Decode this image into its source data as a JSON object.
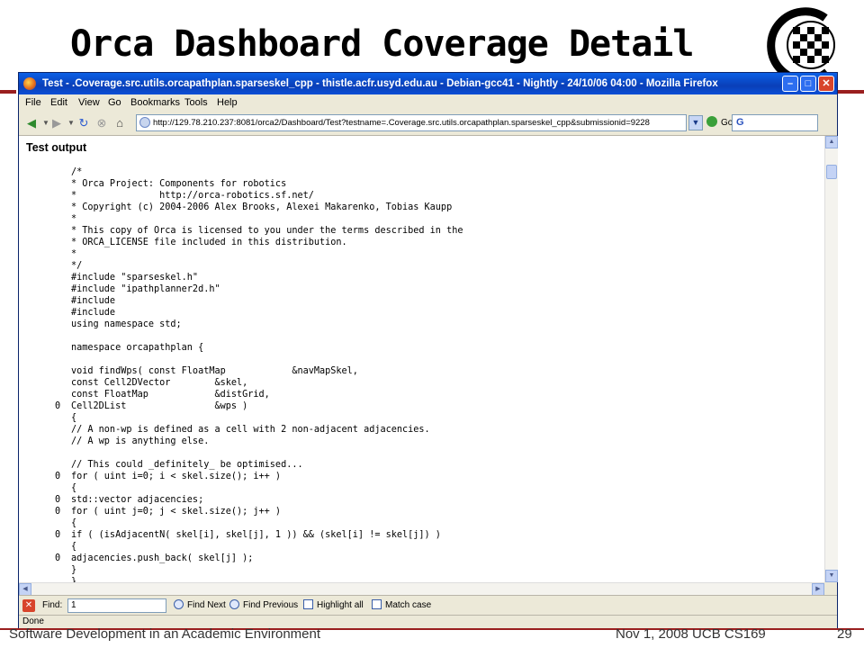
{
  "slide": {
    "title": "Orca Dashboard Coverage Detail",
    "footer_left": "Software Development in an Academic Environment",
    "footer_date": "Nov 1, 2008 UCB CS169",
    "page_number": "29",
    "accent_color": "#9a1f1f"
  },
  "window": {
    "title": "Test - .Coverage.src.utils.orcapathplan.sparseskel_cpp - thistle.acfr.usyd.edu.au - Debian-gcc41 - Nightly - 24/10/06 04:00 - Mozilla Firefox",
    "controls": [
      "minimize",
      "maximize",
      "close"
    ]
  },
  "menu": [
    "File",
    "Edit",
    "View",
    "Go",
    "Bookmarks",
    "Tools",
    "Help"
  ],
  "navbar": {
    "url": "http://129.78.210.237:8081/orca2/Dashboard/Test?testname=.Coverage.src.utils.orcapathplan.sparseskel_cpp&submissionid=9228",
    "go_label": "Go",
    "search_value": "G"
  },
  "content": {
    "heading": "Test output",
    "lines": [
      {
        "count": "",
        "text": "/*"
      },
      {
        "count": "",
        "text": "* Orca Project: Components for robotics"
      },
      {
        "count": "",
        "text": "*               http://orca-robotics.sf.net/"
      },
      {
        "count": "",
        "text": "* Copyright (c) 2004-2006 Alex Brooks, Alexei Makarenko, Tobias Kaupp"
      },
      {
        "count": "",
        "text": "*"
      },
      {
        "count": "",
        "text": "* This copy of Orca is licensed to you under the terms described in the"
      },
      {
        "count": "",
        "text": "* ORCA_LICENSE file included in this distribution."
      },
      {
        "count": "",
        "text": "*"
      },
      {
        "count": "",
        "text": "*/"
      },
      {
        "count": "",
        "text": "#include \"sparseskel.h\""
      },
      {
        "count": "",
        "text": "#include \"ipathplanner2d.h\""
      },
      {
        "count": "",
        "text": "#include"
      },
      {
        "count": "",
        "text": "#include"
      },
      {
        "count": "",
        "text": "using namespace std;"
      },
      {
        "count": "",
        "text": ""
      },
      {
        "count": "",
        "text": "namespace orcapathplan {"
      },
      {
        "count": "",
        "text": ""
      },
      {
        "count": "",
        "text": "void findWps( const FloatMap            &navMapSkel,"
      },
      {
        "count": "",
        "text": "const Cell2DVector        &skel,"
      },
      {
        "count": "",
        "text": "const FloatMap            &distGrid,"
      },
      {
        "count": "0",
        "text": "Cell2DList                &wps )"
      },
      {
        "count": "",
        "text": "{"
      },
      {
        "count": "",
        "text": "// A non-wp is defined as a cell with 2 non-adjacent adjacencies."
      },
      {
        "count": "",
        "text": "// A wp is anything else."
      },
      {
        "count": "",
        "text": ""
      },
      {
        "count": "",
        "text": "// This could _definitely_ be optimised..."
      },
      {
        "count": "0",
        "text": "for ( uint i=0; i < skel.size(); i++ )"
      },
      {
        "count": "",
        "text": "{"
      },
      {
        "count": "0",
        "text": "std::vector adjacencies;"
      },
      {
        "count": "0",
        "text": "for ( uint j=0; j < skel.size(); j++ )"
      },
      {
        "count": "",
        "text": "{"
      },
      {
        "count": "0",
        "text": "if ( (isAdjacentN( skel[i], skel[j], 1 )) && (skel[i] != skel[j]) )"
      },
      {
        "count": "",
        "text": "{"
      },
      {
        "count": "0",
        "text": "adjacencies.push_back( skel[j] );"
      },
      {
        "count": "",
        "text": "}"
      },
      {
        "count": "",
        "text": "}"
      }
    ]
  },
  "findbar": {
    "label": "Find:",
    "value": "1",
    "find_next": "Find Next",
    "find_previous": "Find Previous",
    "highlight_all": "Highlight all",
    "match_case": "Match case"
  },
  "status": "Done"
}
